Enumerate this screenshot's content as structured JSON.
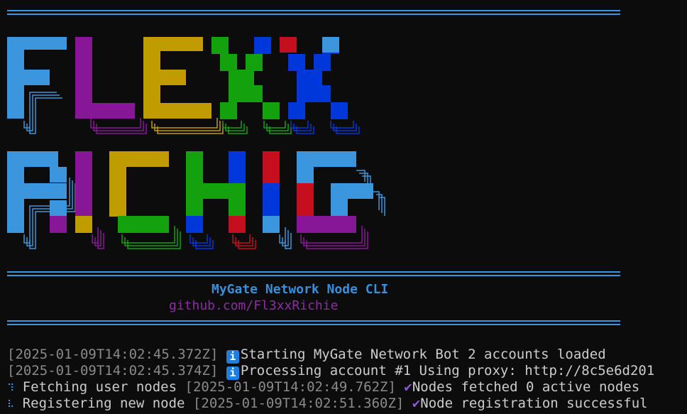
{
  "banner": {
    "line1": "FLEXX",
    "line2": "RICHIE",
    "colors": {
      "blue": "#3b96dd",
      "purple": "#881798",
      "yellow": "#c19c00",
      "green": "#13a10e",
      "darkblue": "#0037da",
      "red": "#c50f1f"
    }
  },
  "header": {
    "subtitle": "MyGate Network Node CLI",
    "link": "github.com/Fl3xxRichie"
  },
  "log": [
    {
      "ts": "[2025-01-09T14:02:45.372Z]",
      "icon": "info",
      "text": "Starting MyGate Network Bot 2 accounts loaded"
    },
    {
      "ts": "[2025-01-09T14:02:45.374Z]",
      "icon": "info",
      "text": "Processing account #1 Using proxy: http://8c5e6d201"
    },
    {
      "spinner": "⠹",
      "label": "Fetching user nodes",
      "ts": "[2025-01-09T14:02:49.762Z]",
      "icon": "check",
      "text": "Nodes fetched 0 active nodes"
    },
    {
      "spinner": "⠧",
      "label": "Registering new node",
      "ts": "[2025-01-09T14:02:51.360Z]",
      "icon": "check",
      "text": "Node registration successful"
    }
  ]
}
